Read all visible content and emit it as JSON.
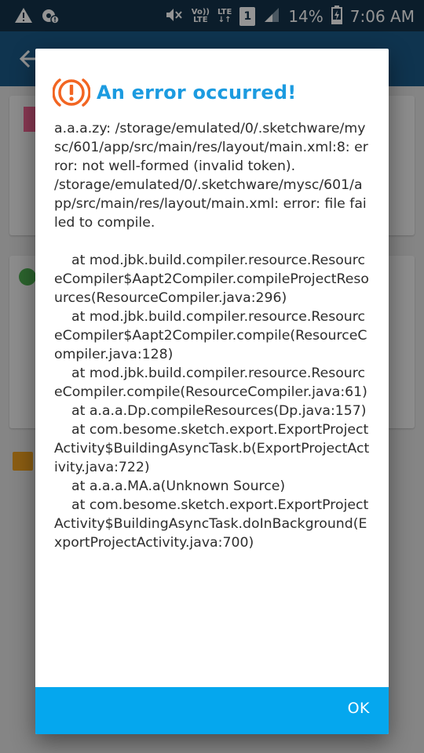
{
  "status_bar": {
    "volte_top": "Vo))",
    "volte_bottom": "LTE",
    "lte_top": "LTE",
    "lte_bottom": "↓↑",
    "sim_number": "1",
    "battery_percent": "14%",
    "time": "7:06 AM"
  },
  "dialog": {
    "title": "An error occurred!",
    "message": "a.a.a.zy: /storage/emulated/0/.sketchware/mysc/601/app/src/main/res/layout/main.xml:8: error: not well-formed (invalid token).\n/storage/emulated/0/.sketchware/mysc/601/app/src/main/res/layout/main.xml: error: file failed to compile.\n\n    at mod.jbk.build.compiler.resource.ResourceCompiler$Aapt2Compiler.compileProjectResources(ResourceCompiler.java:296)\n    at mod.jbk.build.compiler.resource.ResourceCompiler$Aapt2Compiler.compile(ResourceCompiler.java:128)\n    at mod.jbk.build.compiler.resource.ResourceCompiler.compile(ResourceCompiler.java:61)\n    at a.a.a.Dp.compileResources(Dp.java:157)\n    at com.besome.sketch.export.ExportProjectActivity$BuildingAsyncTask.b(ExportProjectActivity.java:722)\n    at a.a.a.MA.a(Unknown Source)\n    at com.besome.sketch.export.ExportProjectActivity$BuildingAsyncTask.doInBackground(ExportProjectActivity.java:700)",
    "ok_label": "OK"
  },
  "colors": {
    "title": "#1c9be0",
    "icon": "#f26522",
    "footer": "#05a7ee",
    "app_bar": "#1b5a88",
    "status_bar": "#14324a"
  }
}
